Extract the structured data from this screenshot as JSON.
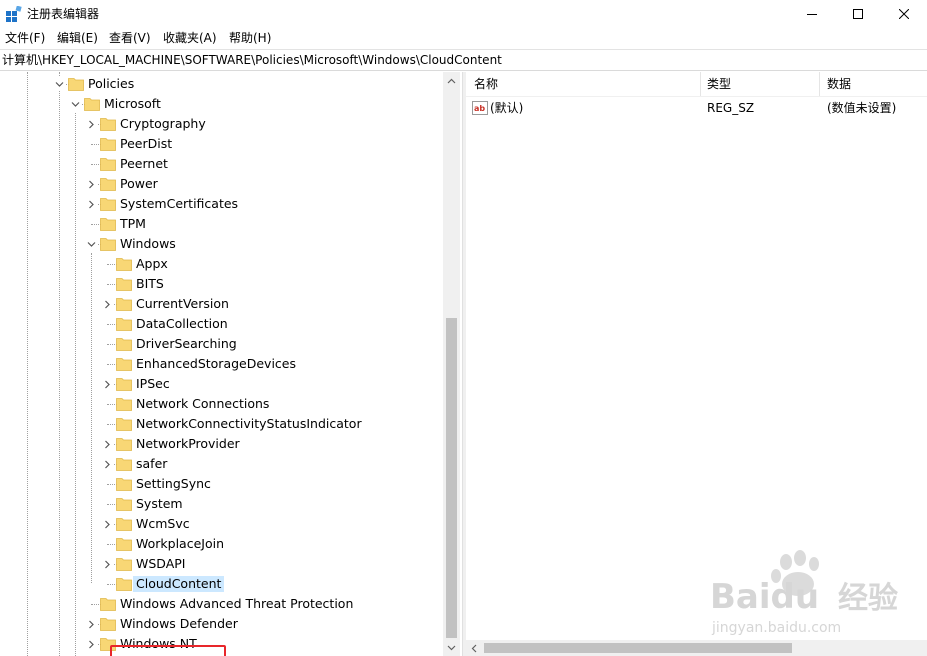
{
  "window": {
    "title": "注册表编辑器",
    "minimize_icon": "minimize-icon",
    "maximize_icon": "maximize-icon",
    "close_icon": "close-icon"
  },
  "menu": [
    "文件(F)",
    "编辑(E)",
    "查看(V)",
    "收藏夹(A)",
    "帮助(H)"
  ],
  "address": "计算机\\HKEY_LOCAL_MACHINE\\SOFTWARE\\Policies\\Microsoft\\Windows\\CloudContent",
  "tree": {
    "policies": "Policies",
    "microsoft": "Microsoft",
    "microsoft_children": [
      "Cryptography",
      "PeerDist",
      "Peernet",
      "Power",
      "SystemCertificates",
      "TPM",
      "Windows"
    ],
    "windows_children": [
      "Appx",
      "BITS",
      "CurrentVersion",
      "DataCollection",
      "DriverSearching",
      "EnhancedStorageDevices",
      "IPSec",
      "Network Connections",
      "NetworkConnectivityStatusIndicator",
      "NetworkProvider",
      "safer",
      "SettingSync",
      "System",
      "WcmSvc",
      "WorkplaceJoin",
      "WSDAPI",
      "CloudContent"
    ],
    "after_windows": [
      "Windows Advanced Threat Protection",
      "Windows Defender",
      "Windows NT"
    ],
    "selected": "CloudContent"
  },
  "list": {
    "headers": {
      "name": "名称",
      "type": "类型",
      "data": "数据"
    },
    "rows": [
      {
        "icon": "string-value-icon",
        "name": "(默认)",
        "type": "REG_SZ",
        "data": "(数值未设置)"
      }
    ]
  },
  "watermark": {
    "brand": "Baidu",
    "brand_cn": "经验",
    "url": "jingyan.baidu.com"
  },
  "colors": {
    "selection": "#cce8ff",
    "highlight_box": "#e8262a",
    "folder": "#f8d775"
  }
}
